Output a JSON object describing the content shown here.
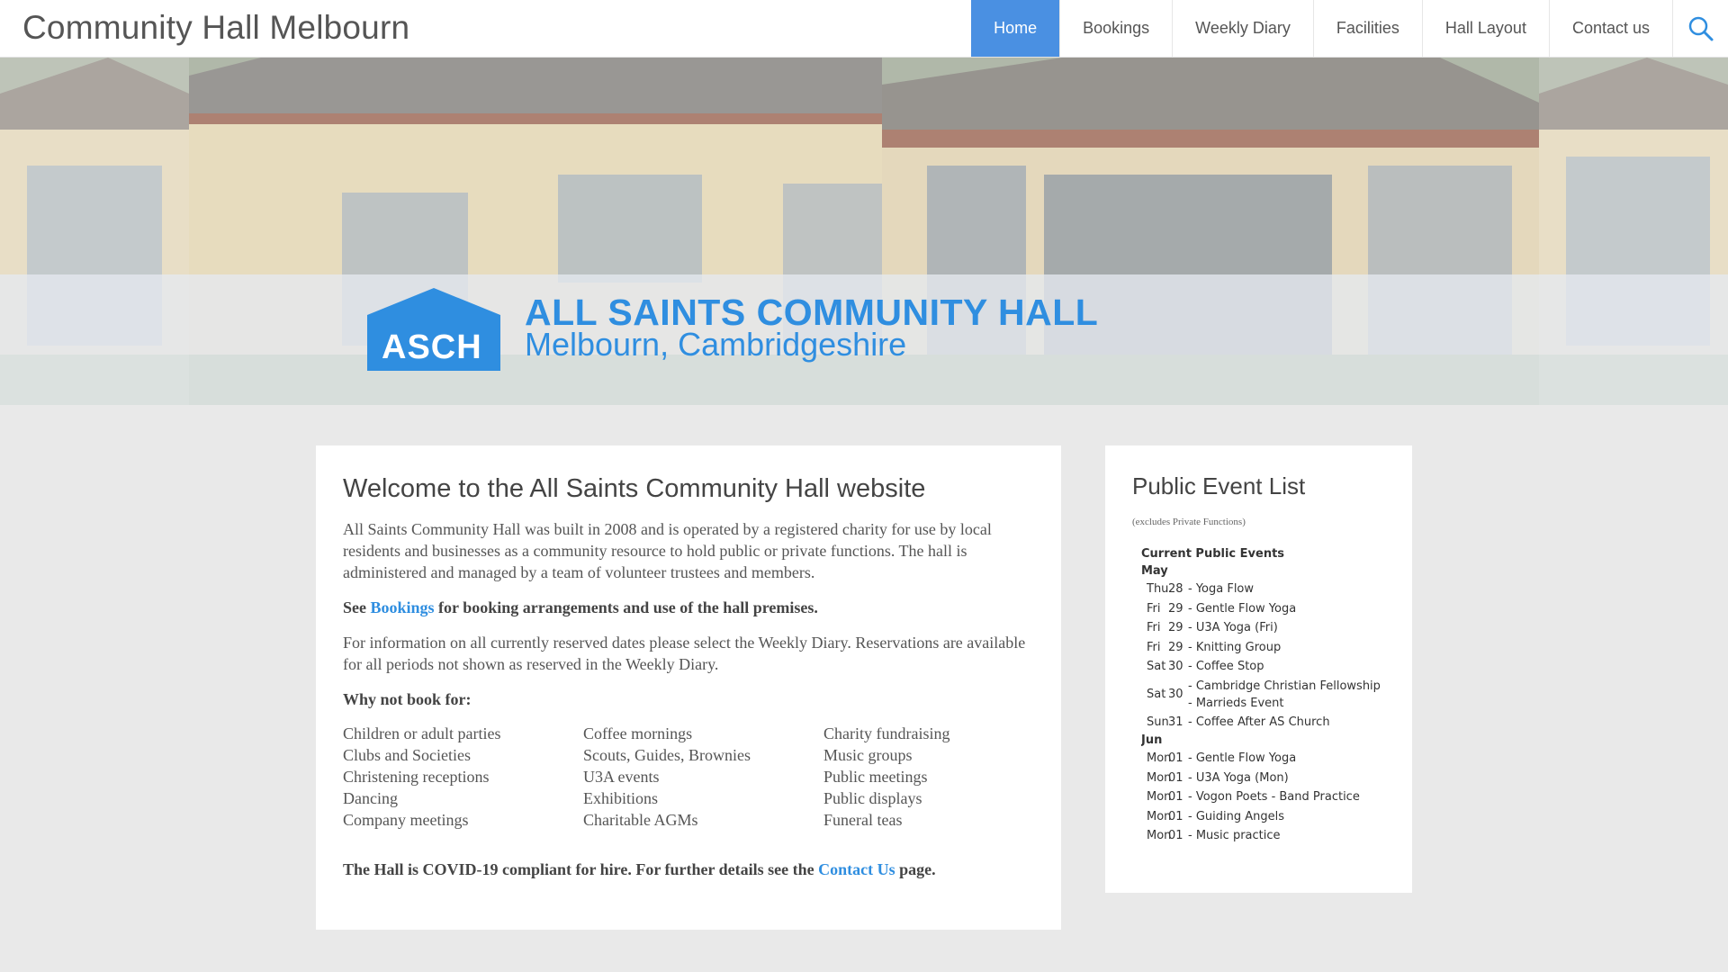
{
  "header": {
    "site_title": "Community Hall Melbourn",
    "nav": [
      {
        "label": "Home",
        "active": true
      },
      {
        "label": "Bookings"
      },
      {
        "label": "Weekly Diary"
      },
      {
        "label": "Facilities"
      },
      {
        "label": "Hall Layout"
      },
      {
        "label": "Contact us"
      }
    ],
    "search_icon": "search-icon"
  },
  "hero": {
    "logo_text": "ASCH",
    "title": "ALL SAINTS COMMUNITY HALL",
    "subtitle": "Melbourn, Cambridgeshire"
  },
  "main": {
    "title": "Welcome to the All Saints Community Hall website",
    "intro": "All Saints Community Hall was built in 2008 and is operated by a registered charity for use by local residents and businesses as a community resource to hold public or private functions. The hall is administered and managed by a team of volunteer trustees and members.",
    "bookings_prefix": "See",
    "bookings_link": "Bookings",
    "bookings_suffix": "for booking arrangements and use of the hall premises.",
    "diary_text": "For information on all currently reserved dates please select the Weekly Diary. Reservations are available for all periods not shown as reserved in the Weekly Diary.",
    "why_heading": "Why not book for:",
    "uses_col1": [
      "Children or adult parties",
      "Clubs and Societies",
      "Christening receptions",
      "Dancing",
      "Company meetings"
    ],
    "uses_col2": [
      "Coffee mornings",
      "Scouts, Guides, Brownies",
      "U3A events",
      "Exhibitions",
      "Charitable AGMs"
    ],
    "uses_col3": [
      "Charity fundraising",
      "Music groups",
      "Public meetings",
      "Public displays",
      "Funeral teas"
    ],
    "covid_prefix": "The Hall is COVID-19 compliant for hire. For further details see the",
    "covid_link": "Contact Us",
    "covid_suffix": "page."
  },
  "sidebar": {
    "title": "Public Event List",
    "note": "(excludes Private Functions)",
    "events_heading": "Current Public Events",
    "months": [
      {
        "name": "May",
        "events": [
          {
            "day": "Thu",
            "date": "28",
            "name": "- Yoga Flow"
          },
          {
            "day": "Fri",
            "date": "29",
            "name": "- Gentle Flow Yoga"
          },
          {
            "day": "Fri",
            "date": "29",
            "name": "- U3A Yoga (Fri)"
          },
          {
            "day": "Fri",
            "date": "29",
            "name": "- Knitting Group"
          },
          {
            "day": "Sat",
            "date": "30",
            "name": "- Coffee Stop"
          },
          {
            "day": "Sat",
            "date": "30",
            "name": "- Cambridge Christian Fellowship - Marrieds Event"
          },
          {
            "day": "Sun",
            "date": "31",
            "name": "- Coffee After AS Church"
          }
        ]
      },
      {
        "name": "Jun",
        "events": [
          {
            "day": "Mon",
            "date": "01",
            "name": "- Gentle Flow Yoga"
          },
          {
            "day": "Mon",
            "date": "01",
            "name": "- U3A Yoga (Mon)"
          },
          {
            "day": "Mon",
            "date": "01",
            "name": "- Vogon Poets - Band Practice"
          },
          {
            "day": "Mon",
            "date": "01",
            "name": "- Guiding Angels"
          },
          {
            "day": "Mon",
            "date": "01",
            "name": "- Music practice"
          }
        ]
      }
    ]
  },
  "colors": {
    "accent": "#4a90e2",
    "brand_blue": "#2f8ee0",
    "page_bg": "#e9e9e9"
  }
}
